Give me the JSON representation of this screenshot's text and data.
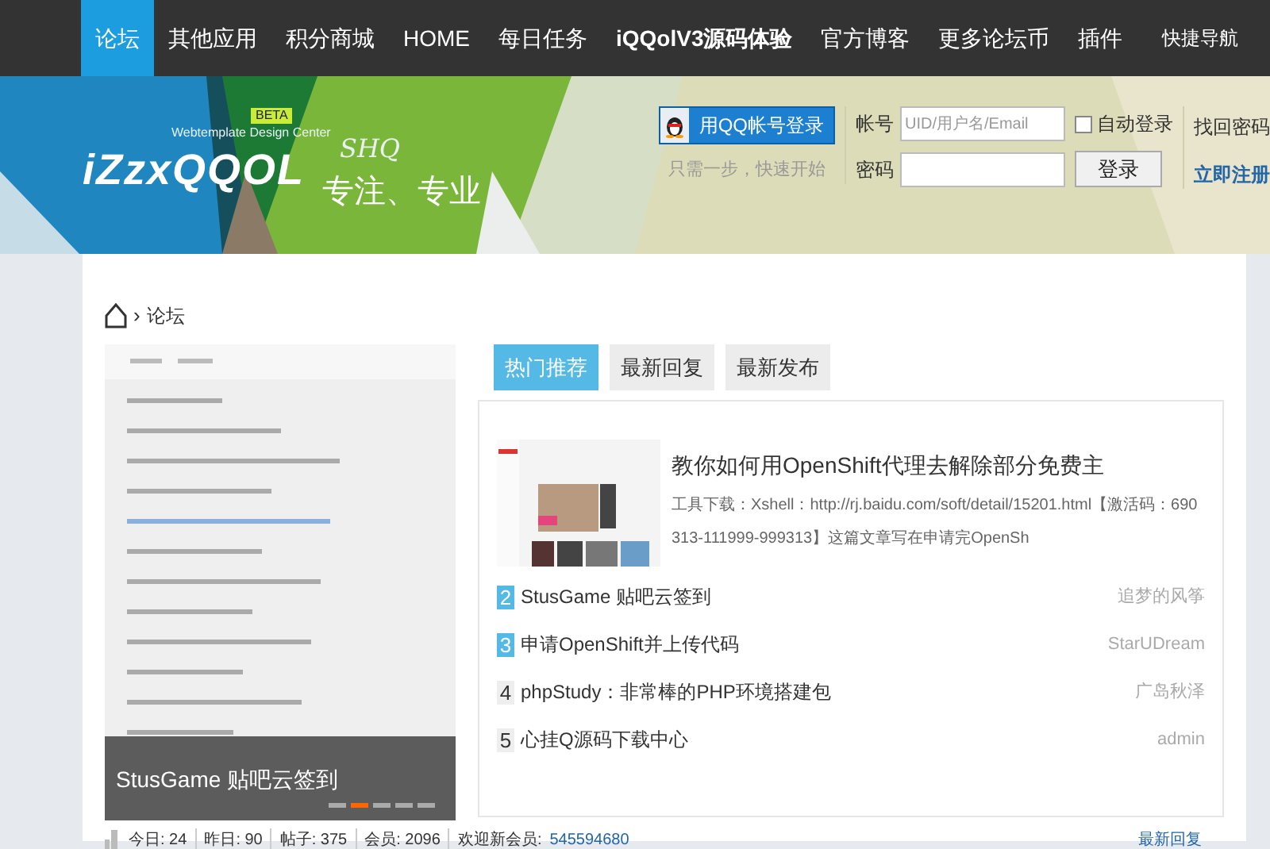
{
  "nav": {
    "items": [
      {
        "label": "论坛",
        "selected": true,
        "bold": false
      },
      {
        "label": "其他应用",
        "selected": false,
        "bold": false
      },
      {
        "label": "积分商城",
        "selected": false,
        "bold": false
      },
      {
        "label": "HOME",
        "selected": false,
        "bold": false
      },
      {
        "label": "每日任务",
        "selected": false,
        "bold": false
      },
      {
        "label": "iQQolV3源码体验",
        "selected": false,
        "bold": true
      },
      {
        "label": "官方博客",
        "selected": false,
        "bold": false
      },
      {
        "label": "更多论坛币",
        "selected": false,
        "bold": false
      },
      {
        "label": "插件",
        "selected": false,
        "bold": false
      }
    ],
    "quick_nav": "快捷导航"
  },
  "logo": {
    "badge": "BETA",
    "tagline": "Webtemplate Design Center",
    "name": "iZzxQQOL",
    "mark": "SHQ",
    "slogan": "专注、专业"
  },
  "login": {
    "qq_button": "用QQ帐号登录",
    "qq_hint": "只需一步，快速开始",
    "account_label": "帐号",
    "account_placeholder": "UID/用户名/Email",
    "auto_login": {
      "label": "自动登录",
      "checked": false
    },
    "find_password": "找回密码",
    "password_label": "密码",
    "login_button": "登录",
    "register": "立即注册"
  },
  "breadcrumb": {
    "separator": "›",
    "current": "论坛"
  },
  "slider": {
    "caption": "StusGame 贴吧云签到",
    "dots": [
      {
        "selected": false
      },
      {
        "selected": true
      },
      {
        "selected": false
      },
      {
        "selected": false
      },
      {
        "selected": false
      }
    ]
  },
  "tabs": [
    {
      "label": "热门推荐",
      "selected": true
    },
    {
      "label": "最新回复",
      "selected": false
    },
    {
      "label": "最新发布",
      "selected": false
    }
  ],
  "featured": {
    "title": "教你如何用OpenShift代理去解除部分免费主",
    "excerpt": "工具下载：Xshell：http://rj.baidu.com/soft/detail/15201.html【激活码：690313-111999-999313】这篇文章写在申请完OpenSh"
  },
  "posts": [
    {
      "rank": "2",
      "title": "StusGame 贴吧云签到",
      "author": "追梦的风筝",
      "highlight": true
    },
    {
      "rank": "3",
      "title": "申请OpenShift并上传代码",
      "author": "StarUDream",
      "highlight": true
    },
    {
      "rank": "4",
      "title": "phpStudy：非常棒的PHP环境搭建包",
      "author": "广岛秋泽",
      "highlight": false
    },
    {
      "rank": "5",
      "title": "心挂Q源码下载中心",
      "author": "admin",
      "highlight": false
    }
  ],
  "stats": {
    "items": [
      "今日: 24",
      "昨日: 90",
      "帖子: 375",
      "会员: 2096"
    ],
    "new_member_label": "欢迎新会员:",
    "new_member": "545594680",
    "latest_link": "最新回复"
  }
}
